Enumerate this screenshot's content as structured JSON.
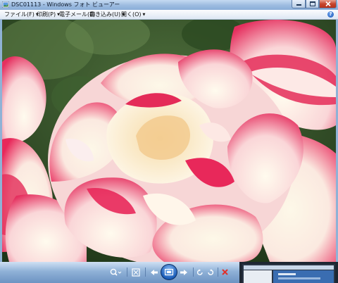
{
  "window": {
    "title": "DSC01113 - Windows フォト ビューアー",
    "caption_buttons": [
      "minimize",
      "maximize",
      "close"
    ]
  },
  "menu": {
    "items": [
      {
        "label": "ファイル(F)"
      },
      {
        "label": "印刷(P)"
      },
      {
        "label": "電子メール(E)"
      },
      {
        "label": "書き込み(U)"
      },
      {
        "label": "開く(O)"
      }
    ],
    "help_label": "?"
  },
  "image": {
    "subject": "rose-photo",
    "colors": {
      "petal_edge": "#e8285a",
      "petal_base": "#fbf3dc",
      "leaves": "#3b5f2e"
    }
  },
  "toolbar": {
    "tools": [
      "zoom-icon",
      "actual-size-icon",
      "previous-icon",
      "slideshow-icon",
      "next-icon",
      "rotate-counterclockwise-icon",
      "rotate-clockwise-icon",
      "delete-icon"
    ],
    "accent": "#2a6fd0"
  },
  "taskbar_thumbnail": {
    "label": ""
  }
}
